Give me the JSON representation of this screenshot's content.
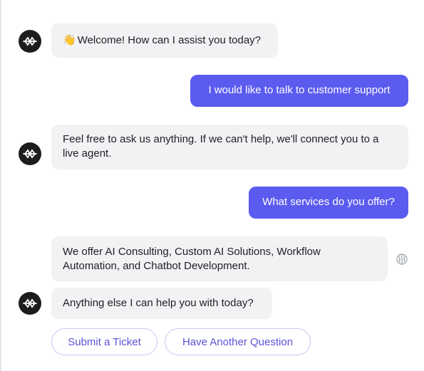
{
  "messages": {
    "m1": {
      "emoji": "👋",
      "text": "Welcome! How can I assist you today?"
    },
    "m2": {
      "text": "I would like to talk to customer support"
    },
    "m3": {
      "text": "Feel free to ask us anything. If we can't help, we'll connect you to a live agent."
    },
    "m4": {
      "text": "What services do you offer?"
    },
    "m5": {
      "text": "We offer AI Consulting, Custom AI Solutions, Workflow Automation, and Chatbot Development."
    },
    "m6": {
      "text": "Anything else I can help you with today?"
    }
  },
  "quick_replies": [
    {
      "label": "Submit a Ticket"
    },
    {
      "label": "Have Another Question"
    }
  ],
  "icons": {
    "bot_avatar": "bot-logo-icon",
    "side_action": "brain-icon"
  },
  "colors": {
    "user_bubble": "#5b5bf0",
    "bot_bubble": "#f2f2f4",
    "avatar": "#1d1d20",
    "chip_text": "#5b52d6",
    "chip_border": "#c9c5f3"
  }
}
